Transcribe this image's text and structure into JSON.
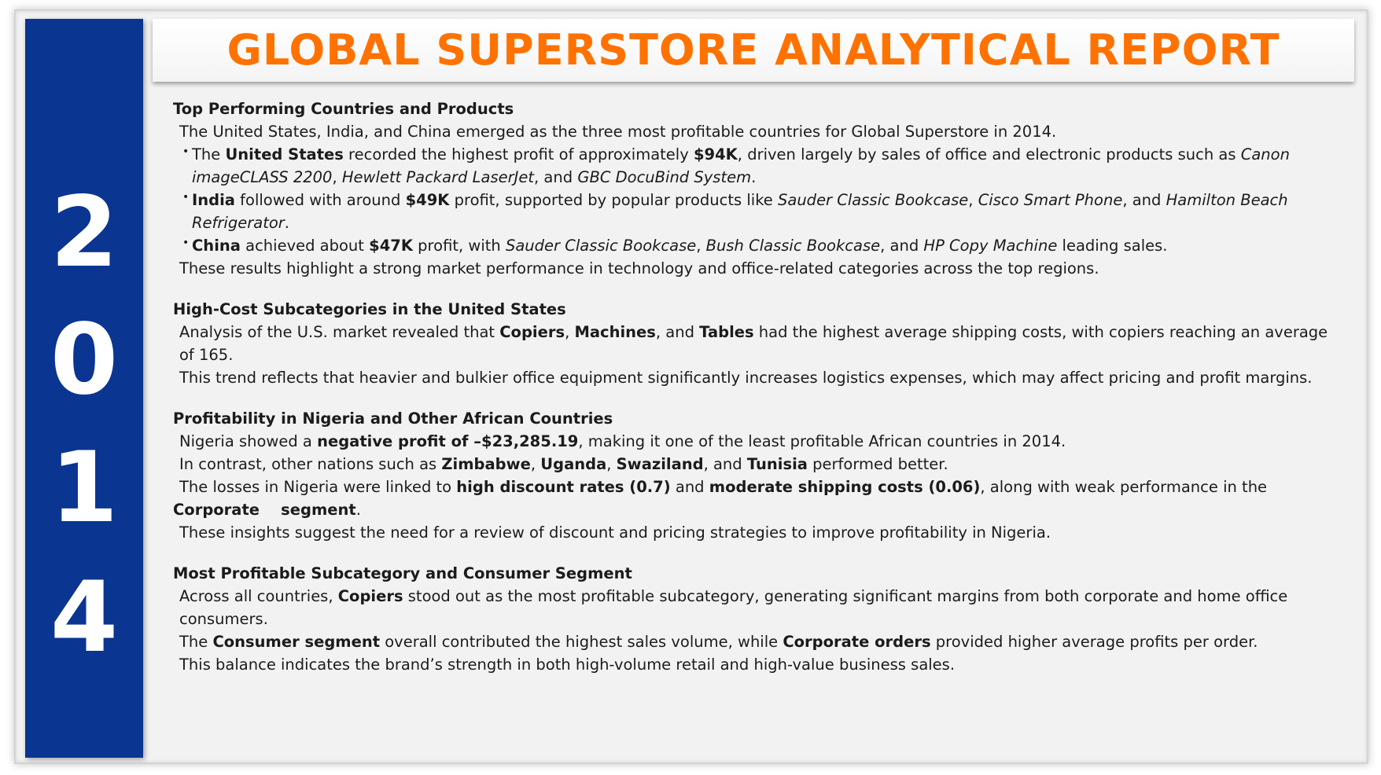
{
  "title": "GLOBAL SUPERSTORE ANALYTICAL REPORT",
  "year_digits": [
    "2",
    "0",
    "1",
    "4"
  ],
  "colors": {
    "sidebar": "#0a3591",
    "title": "#ff7200",
    "background": "#f2f2f2"
  },
  "icons": {
    "bullet": "•"
  },
  "sections": {
    "top": {
      "heading": "Top Performing Countries and Products",
      "intro": "The United States, India, and China emerged as the three most profitable countries for Global Superstore in 2014.",
      "us": {
        "pre": "The ",
        "country": "United States",
        "mid": " recorded the highest profit of approximately ",
        "profit": "$94K",
        "mid2": ", driven largely by sales of office and electronic products such as ",
        "p1": "Canon imageCLASS 2200",
        "sep1": ", ",
        "p2": "Hewlett Packard LaserJet",
        "sep2": ", and ",
        "p3": "GBC DocuBind System",
        "end": "."
      },
      "india": {
        "country": "India",
        "mid": " followed with around ",
        "profit": "$49K",
        "mid2": " profit, supported by popular products like ",
        "p1": "Sauder Classic Bookcase",
        "sep1": ", ",
        "p2": "Cisco Smart Phone",
        "sep2": ", and ",
        "p3": "Hamilton Beach Refrigerator",
        "end": "."
      },
      "china": {
        "country": "China",
        "mid": " achieved about ",
        "profit": "$47K",
        "mid2": " profit, with ",
        "p1": "Sauder Classic Bookcase",
        "sep1": ", ",
        "p2": "Bush Classic Bookcase",
        "sep2": ", and ",
        "p3": "HP Copy Machine",
        "end": " leading sales."
      },
      "outro": "These results highlight a strong market performance in technology and office-related categories across the top regions."
    },
    "us_costs": {
      "heading": "High-Cost Subcategories in the United States",
      "l1": {
        "pre": "Analysis of the U.S. market revealed that ",
        "b1": "Copiers",
        "s1": ", ",
        "b2": "Machines",
        "s2": ", and ",
        "b3": "Tables",
        "end": " had the highest average shipping costs, with copiers reaching an average of 165."
      },
      "l2": "This trend reflects that heavier and bulkier office equipment significantly increases logistics expenses, which may affect pricing and profit margins."
    },
    "nigeria": {
      "heading": "Profitability in Nigeria and Other African Countries",
      "l1": {
        "pre": "Nigeria showed a ",
        "b": "negative profit of –$23,285.19",
        "end": ", making it one of the least profitable African countries in 2014."
      },
      "l2": {
        "pre": "In contrast, other nations such as ",
        "b1": "Zimbabwe",
        "s1": ", ",
        "b2": "Uganda",
        "s2": ", ",
        "b3": "Swaziland",
        "s3": ", and ",
        "b4": "Tunisia",
        "end": " performed better."
      },
      "l3": {
        "pre": "The losses in Nigeria were linked to ",
        "b1": "high discount rates (0.7)",
        "s1": " and ",
        "b2": "moderate shipping costs (0.06)",
        "end": ", along with weak performance in the"
      },
      "l4": {
        "b": "Corporate    segment",
        "end": "."
      },
      "l5": "These insights suggest the need for a review of discount and pricing strategies to improve profitability in Nigeria."
    },
    "consumer": {
      "heading": "Most Profitable Subcategory and Consumer Segment",
      "l1": {
        "pre": "Across all countries, ",
        "b": "Copiers",
        "end": " stood out as the most profitable subcategory, generating significant margins from both corporate and home office consumers."
      },
      "l2": {
        "pre": "The ",
        "b1": "Consumer segment",
        "s1": " overall contributed the highest sales volume, while ",
        "b2": "Corporate orders",
        "end": " provided higher average profits per order."
      },
      "l3": "This balance indicates the brand’s strength in both high-volume retail and high-value business sales."
    }
  }
}
